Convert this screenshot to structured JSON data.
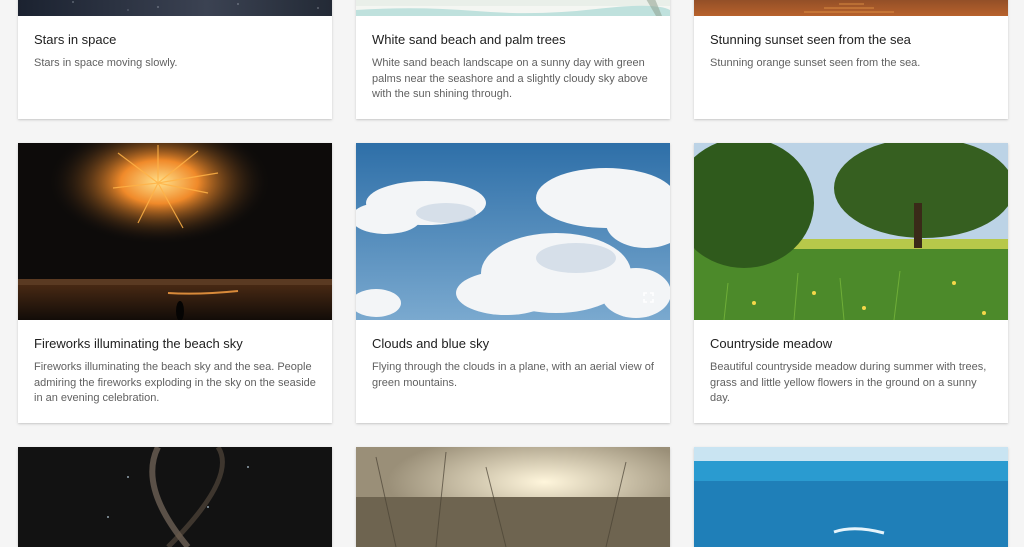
{
  "cards": [
    {
      "title": "Stars in space",
      "description": "Stars in space moving slowly."
    },
    {
      "title": "White sand beach and palm trees",
      "description": "White sand beach landscape on a sunny day with green palms near the seashore and a slightly cloudy sky above with the sun shining through."
    },
    {
      "title": "Stunning sunset seen from the sea",
      "description": "Stunning orange sunset seen from the sea."
    },
    {
      "title": "Fireworks illuminating the beach sky",
      "description": "Fireworks illuminating the beach sky and the sea. People admiring the fireworks exploding in the sky on the seaside in an evening celebration."
    },
    {
      "title": "Clouds and blue sky",
      "description": "Flying through the clouds in a plane, with an aerial view of green mountains."
    },
    {
      "title": "Countryside meadow",
      "description": "Beautiful countryside meadow during summer with trees, grass and little yellow flowers in the ground on a sunny day."
    },
    {
      "title": "",
      "description": ""
    },
    {
      "title": "",
      "description": ""
    },
    {
      "title": "",
      "description": ""
    }
  ],
  "icons": {
    "expand": "fullscreen-expand-icon"
  }
}
